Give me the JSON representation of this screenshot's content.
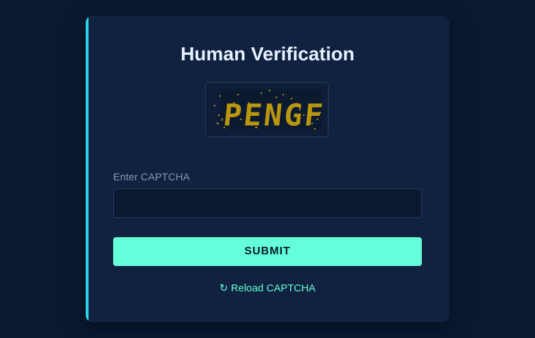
{
  "card": {
    "title": "Human Verification"
  },
  "captcha": {
    "image_text": "PENGF",
    "text_color": "#b8960f"
  },
  "form": {
    "label": "Enter CAPTCHA",
    "input_value": "",
    "placeholder": ""
  },
  "actions": {
    "submit_label": "SUBMIT",
    "reload_icon": "↻",
    "reload_label": "Reload CAPTCHA"
  },
  "colors": {
    "background": "#0b192f",
    "card": "#112240",
    "accent": "#64ffda",
    "edge_accent": "#28d7e6"
  }
}
